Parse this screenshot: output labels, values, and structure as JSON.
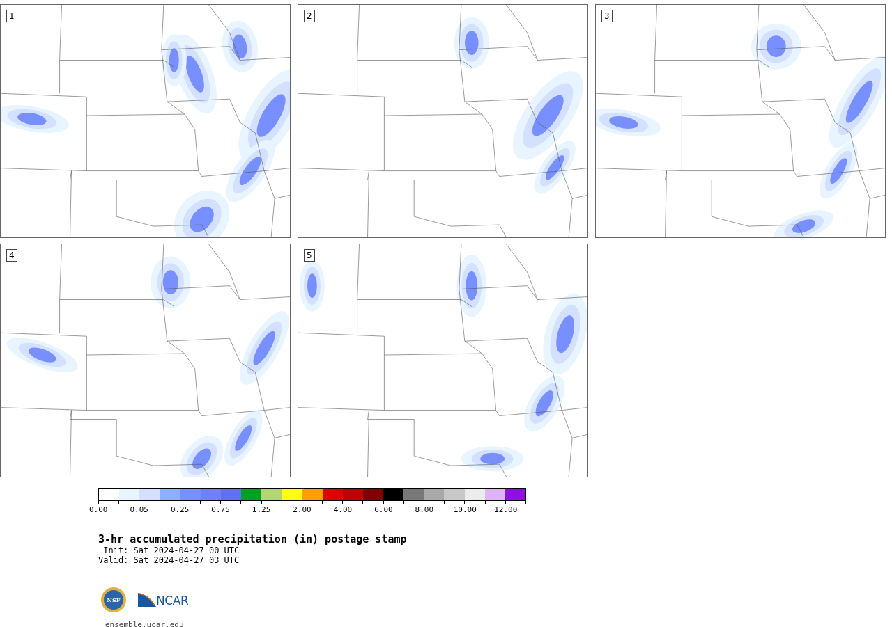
{
  "panels": [
    {
      "label": "1"
    },
    {
      "label": "2"
    },
    {
      "label": "3"
    },
    {
      "label": "4"
    },
    {
      "label": "5"
    }
  ],
  "colorbar": {
    "swatches": [
      {
        "color": "#ffffff"
      },
      {
        "color": "#e8f4ff"
      },
      {
        "color": "#d4e0ff"
      },
      {
        "color": "#8cb0ff"
      },
      {
        "color": "#7890ff"
      },
      {
        "color": "#7080f8"
      },
      {
        "color": "#6070f0"
      },
      {
        "color": "#00a020"
      },
      {
        "color": "#b4d474"
      },
      {
        "color": "#ffff10"
      },
      {
        "color": "#ffa000"
      },
      {
        "color": "#e00000"
      },
      {
        "color": "#c00000"
      },
      {
        "color": "#800000"
      },
      {
        "color": "#000000"
      },
      {
        "color": "#787878"
      },
      {
        "color": "#a8a8a8"
      },
      {
        "color": "#c8c8c8"
      },
      {
        "color": "#ececec"
      },
      {
        "color": "#e0b4f4"
      },
      {
        "color": "#9010e0"
      }
    ],
    "labels": [
      "0.00",
      "0.05",
      "0.25",
      "0.75",
      "1.25",
      "2.00",
      "4.00",
      "6.00",
      "8.00",
      "10.00",
      "12.00"
    ]
  },
  "title": "3-hr accumulated precipitation (in) postage stamp",
  "init": " Init: Sat 2024-04-27 00 UTC",
  "valid": "Valid: Sat 2024-04-27 03 UTC",
  "logo": {
    "nsf": "NSF",
    "ncar": "NCAR"
  },
  "url": "ensemble.ucar.edu"
}
